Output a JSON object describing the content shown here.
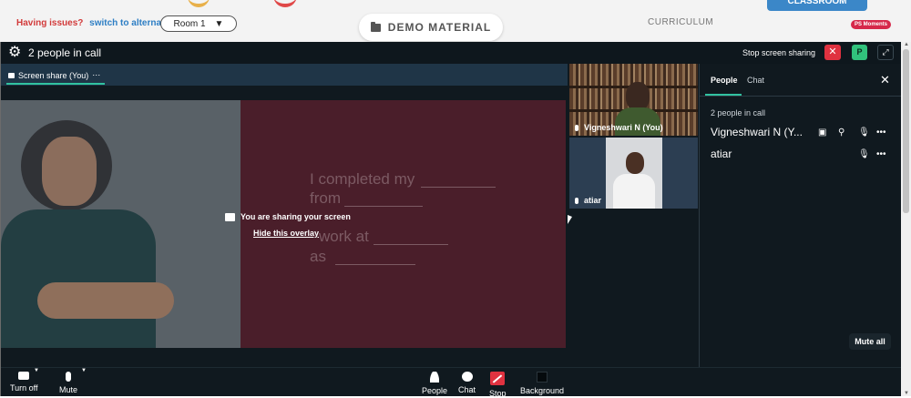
{
  "topbar": {
    "issues_text": "Having issues?",
    "alternate_link": "switch to alternate room",
    "room_value": "Room 1",
    "demo_material_label": "DEMO MATERIAL",
    "curriculum_label": "CURRICULUM",
    "classroom_tab": "CLASSROOM",
    "ps_moments": "PS Moments"
  },
  "call": {
    "title": "2 people in call",
    "stop_sharing_label": "Stop screen sharing",
    "p_badge": "P"
  },
  "screen_share": {
    "tab_label": "Screen share (You)",
    "tab_menu": "⋯",
    "overlay_message": "You are sharing your screen",
    "hide_overlay_label": "Hide this overlay",
    "slide_lines": [
      "I completed my",
      "from",
      "work at",
      "as"
    ]
  },
  "tiles": [
    {
      "name": "Vigneshwari N (You)"
    },
    {
      "name": "atiar"
    }
  ],
  "panel": {
    "tab_people": "People",
    "tab_chat": "Chat",
    "count_text": "2 people in call",
    "participants": [
      {
        "name": "Vigneshwari N (Y..."
      },
      {
        "name": "atiar"
      }
    ],
    "mute_all_label": "Mute all"
  },
  "bottombar": {
    "turn_off_label": "Turn off",
    "mute_label": "Mute",
    "people_label": "People",
    "chat_label": "Chat",
    "stop_label": "Stop",
    "background_label": "Background"
  },
  "colors": {
    "accent_teal": "#31c2a0",
    "danger_red": "#e03240",
    "p_green": "#31c27c",
    "call_bg": "#10191f"
  }
}
